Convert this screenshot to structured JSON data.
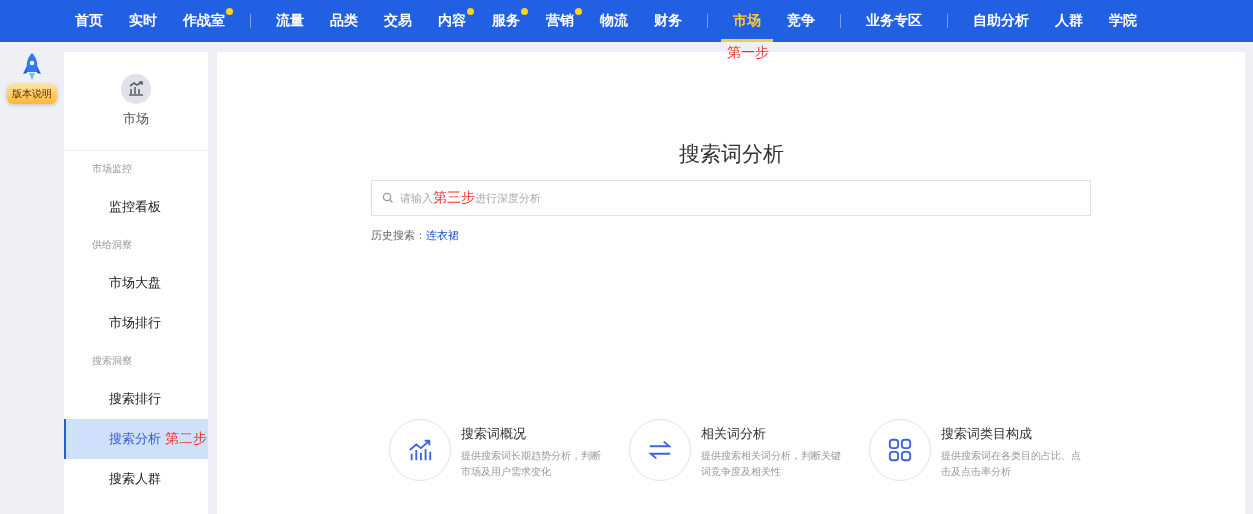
{
  "nav": {
    "groups": [
      [
        {
          "label": "首页",
          "selected": false,
          "badge": false
        },
        {
          "label": "实时",
          "selected": false,
          "badge": false
        },
        {
          "label": "作战室",
          "selected": false,
          "badge": true
        }
      ],
      [
        {
          "label": "流量",
          "selected": false,
          "badge": false
        },
        {
          "label": "品类",
          "selected": false,
          "badge": false
        },
        {
          "label": "交易",
          "selected": false,
          "badge": false
        },
        {
          "label": "内容",
          "selected": false,
          "badge": true
        },
        {
          "label": "服务",
          "selected": false,
          "badge": true
        },
        {
          "label": "营销",
          "selected": false,
          "badge": true
        },
        {
          "label": "物流",
          "selected": false,
          "badge": false
        },
        {
          "label": "财务",
          "selected": false,
          "badge": false
        }
      ],
      [
        {
          "label": "市场",
          "selected": true,
          "badge": false
        },
        {
          "label": "竞争",
          "selected": false,
          "badge": false
        }
      ],
      [
        {
          "label": "业务专区",
          "selected": false,
          "badge": false
        }
      ],
      [
        {
          "label": "自助分析",
          "selected": false,
          "badge": false
        },
        {
          "label": "人群",
          "selected": false,
          "badge": false
        },
        {
          "label": "学院",
          "selected": false,
          "badge": false
        }
      ]
    ],
    "annotation": "第一步"
  },
  "release_notes": {
    "label": "版本说明"
  },
  "sidebar": {
    "title": "市场",
    "annotation": "第二步",
    "sections": [
      {
        "title": "市场监控",
        "items": [
          {
            "label": "监控看板",
            "selected": false
          }
        ]
      },
      {
        "title": "供给洞察",
        "items": [
          {
            "label": "市场大盘",
            "selected": false
          },
          {
            "label": "市场排行",
            "selected": false
          }
        ]
      },
      {
        "title": "搜索洞察",
        "items": [
          {
            "label": "搜索排行",
            "selected": false
          },
          {
            "label": "搜索分析",
            "selected": true
          },
          {
            "label": "搜索人群",
            "selected": false
          }
        ]
      }
    ]
  },
  "main": {
    "title": "搜索词分析",
    "search": {
      "placeholder_start": "请输入",
      "annotation": "第三步",
      "placeholder_end": "进行深度分析"
    },
    "history": {
      "label": "历史搜索：",
      "items": [
        "连衣裙"
      ]
    },
    "features": [
      {
        "kind": "trend",
        "title": "搜索词概况",
        "description": "提供搜索词长期趋势分析，判断市场及用户需求变化"
      },
      {
        "kind": "swap",
        "title": "相关词分析",
        "description": "提供搜索相关词分析，判断关键词竞争度及相关性"
      },
      {
        "kind": "grid",
        "title": "搜索词类目构成",
        "description": "提供搜索词在各类目的占比、点击及点击率分析"
      }
    ]
  }
}
